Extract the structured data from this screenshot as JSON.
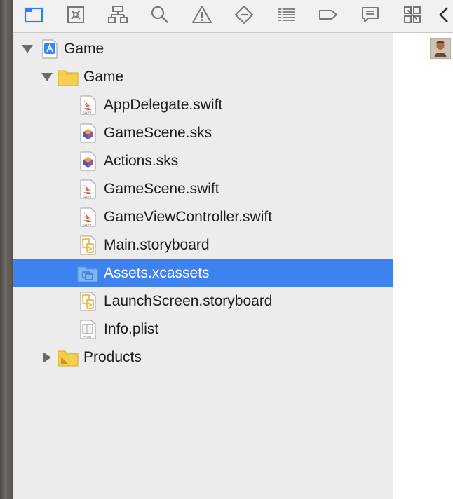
{
  "navigator_toolbar": {
    "icons": [
      "project-navigator-icon",
      "source-control-icon",
      "symbol-navigator-icon",
      "find-icon",
      "issue-icon",
      "test-icon",
      "debug-icon",
      "breakpoint-icon",
      "report-icon"
    ],
    "selected": "project-navigator-icon"
  },
  "tree": {
    "project": {
      "label": "Game"
    },
    "group_game": {
      "label": "Game"
    },
    "files": [
      {
        "label": "AppDelegate.swift"
      },
      {
        "label": "GameScene.sks"
      },
      {
        "label": "Actions.sks"
      },
      {
        "label": "GameScene.swift"
      },
      {
        "label": "GameViewController.swift"
      },
      {
        "label": "Main.storyboard"
      },
      {
        "label": "Assets.xcassets"
      },
      {
        "label": "LaunchScreen.storyboard"
      },
      {
        "label": "Info.plist"
      }
    ],
    "group_products": {
      "label": "Products"
    },
    "selected_file": "Assets.xcassets"
  },
  "colors": {
    "selection": "#3d82ef",
    "toolbar_active": "#2f7cf6",
    "folder": "#f7cf4f"
  }
}
